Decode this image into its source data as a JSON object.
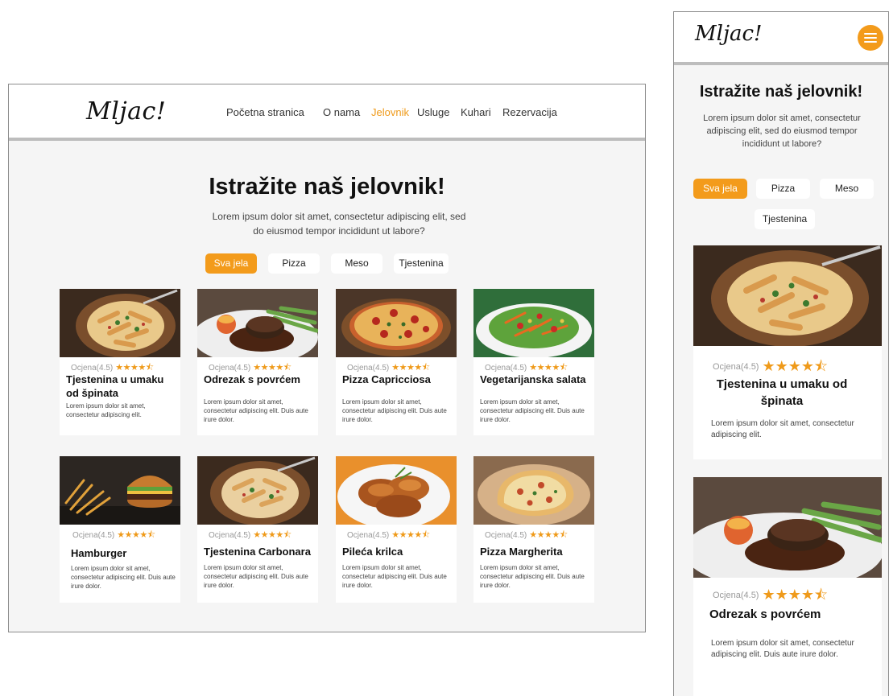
{
  "brand": "Mljac!",
  "nav": [
    "Početna stranica",
    "O nama",
    "Jelovnik",
    "Usluge",
    "Kuhari",
    "Rezervacija"
  ],
  "active_nav": "Jelovnik",
  "hero": {
    "title": "Istražite naš jelovnik!",
    "intro": "Lorem ipsum dolor sit amet, consectetur adipiscing elit, sed do eiusmod tempor incididunt ut labore?"
  },
  "filters": [
    "Sva jela",
    "Pizza",
    "Meso",
    "Tjestenina"
  ],
  "active_filter": "Sva jela",
  "rating_label": "Ocjena(4.5)",
  "stars": "★★★★⯪",
  "desc_short": "Lorem ipsum dolor sit amet, consectetur adipiscing elit.",
  "desc_long": "Lorem ipsum dolor sit amet, consectetur adipiscing elit. Duis aute irure dolor.",
  "dishes": [
    {
      "name": "Tjestenina u umaku od špinata",
      "food_icon": "pasta-icon"
    },
    {
      "name": "Odrezak s povrćem",
      "food_icon": "steak-icon"
    },
    {
      "name": "Pizza Capricciosa",
      "food_icon": "pizza-icon"
    },
    {
      "name": "Vegetarijanska salata",
      "food_icon": "salad-icon"
    },
    {
      "name": "Hamburger",
      "food_icon": "burger-icon"
    },
    {
      "name": "Tjestenina Carbonara",
      "food_icon": "pasta-icon"
    },
    {
      "name": "Pileća krilca",
      "food_icon": "chicken-wings-icon"
    },
    {
      "name": "Pizza Margherita",
      "food_icon": "pizza-icon"
    }
  ],
  "mobile": {
    "menu_icon": "hamburger-menu-icon",
    "mobile_title": "Tjestenina u umaku od špinata"
  },
  "colors": {
    "accent": "#f39b1b",
    "stars": "#ef9a1a",
    "background": "#f5f5f5"
  }
}
